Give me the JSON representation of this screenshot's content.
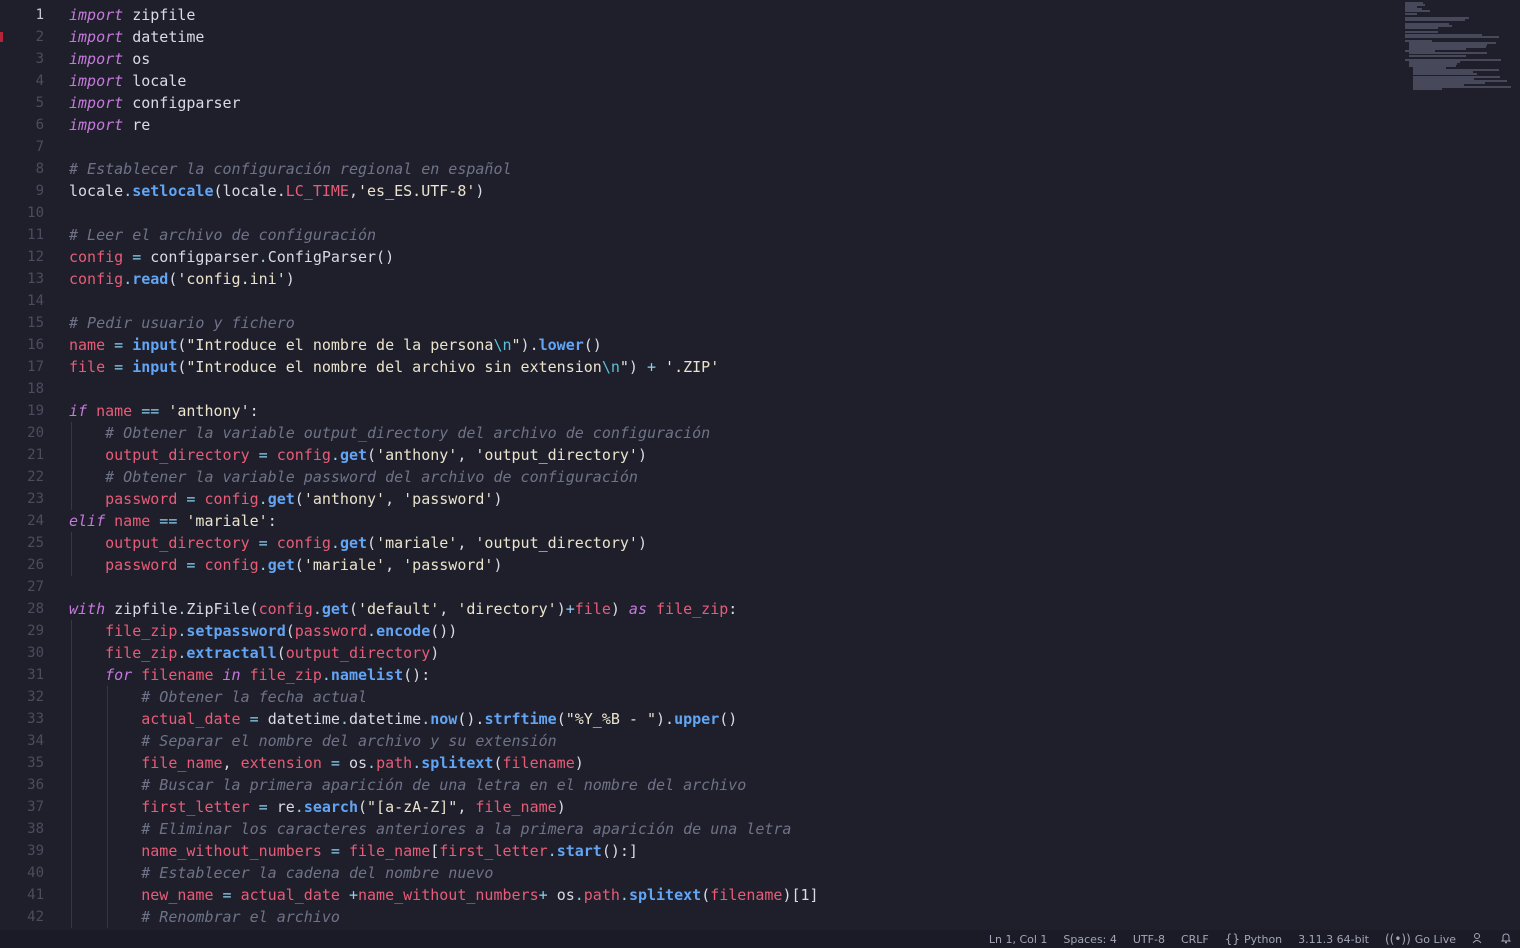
{
  "editor": {
    "language": "python",
    "active_line": 1,
    "lines": [
      {
        "n": "1",
        "indent": 0,
        "tokens": [
          [
            "kw",
            "import"
          ],
          [
            "pl",
            " zipfile"
          ]
        ]
      },
      {
        "n": "2",
        "indent": 0,
        "tokens": [
          [
            "kw",
            "import"
          ],
          [
            "pl",
            " datetime"
          ]
        ]
      },
      {
        "n": "3",
        "indent": 0,
        "tokens": [
          [
            "kw",
            "import"
          ],
          [
            "pl",
            " os"
          ]
        ]
      },
      {
        "n": "4",
        "indent": 0,
        "tokens": [
          [
            "kw",
            "import"
          ],
          [
            "pl",
            " locale"
          ]
        ]
      },
      {
        "n": "5",
        "indent": 0,
        "tokens": [
          [
            "kw",
            "import"
          ],
          [
            "pl",
            " configparser"
          ]
        ]
      },
      {
        "n": "6",
        "indent": 0,
        "tokens": [
          [
            "kw",
            "import"
          ],
          [
            "pl",
            " re"
          ]
        ]
      },
      {
        "n": "7",
        "indent": 0,
        "tokens": []
      },
      {
        "n": "8",
        "indent": 0,
        "tokens": [
          [
            "cm",
            "# Establecer la configuración regional en español"
          ]
        ]
      },
      {
        "n": "9",
        "indent": 0,
        "tokens": [
          [
            "pl",
            "locale"
          ],
          [
            "op",
            "."
          ],
          [
            "fn",
            "setlocale"
          ],
          [
            "pl",
            "(locale."
          ],
          [
            "var",
            "LC_TIME"
          ],
          [
            "pl",
            ","
          ],
          [
            "st",
            "'es_ES.UTF-8'"
          ],
          [
            "pl",
            ")"
          ]
        ]
      },
      {
        "n": "10",
        "indent": 0,
        "tokens": []
      },
      {
        "n": "11",
        "indent": 0,
        "tokens": [
          [
            "cm",
            "# Leer el archivo de configuración"
          ]
        ]
      },
      {
        "n": "12",
        "indent": 0,
        "tokens": [
          [
            "var",
            "config"
          ],
          [
            "op",
            " = "
          ],
          [
            "pl",
            "configparser"
          ],
          [
            "op",
            "."
          ],
          [
            "pl",
            "ConfigParser()"
          ]
        ]
      },
      {
        "n": "13",
        "indent": 0,
        "tokens": [
          [
            "var",
            "config"
          ],
          [
            "op",
            "."
          ],
          [
            "fn",
            "read"
          ],
          [
            "pl",
            "("
          ],
          [
            "st",
            "'config.ini'"
          ],
          [
            "pl",
            ")"
          ]
        ]
      },
      {
        "n": "14",
        "indent": 0,
        "tokens": []
      },
      {
        "n": "15",
        "indent": 0,
        "tokens": [
          [
            "cm",
            "# Pedir usuario y fichero"
          ]
        ]
      },
      {
        "n": "16",
        "indent": 0,
        "tokens": [
          [
            "var",
            "name"
          ],
          [
            "op",
            " = "
          ],
          [
            "fn",
            "input"
          ],
          [
            "pl",
            "("
          ],
          [
            "st",
            "\"Introduce el nombre de la persona"
          ],
          [
            "esc",
            "\\n"
          ],
          [
            "st",
            "\""
          ],
          [
            "pl",
            ")."
          ],
          [
            "fn",
            "lower"
          ],
          [
            "pl",
            "()"
          ]
        ]
      },
      {
        "n": "17",
        "indent": 0,
        "tokens": [
          [
            "var",
            "file"
          ],
          [
            "op",
            " = "
          ],
          [
            "fn",
            "input"
          ],
          [
            "pl",
            "("
          ],
          [
            "st",
            "\"Introduce el nombre del archivo sin extension"
          ],
          [
            "esc",
            "\\n"
          ],
          [
            "st",
            "\""
          ],
          [
            "pl",
            ")"
          ],
          [
            "op",
            " + "
          ],
          [
            "st",
            "'.ZIP'"
          ]
        ]
      },
      {
        "n": "18",
        "indent": 0,
        "tokens": []
      },
      {
        "n": "19",
        "indent": 0,
        "tokens": [
          [
            "kw",
            "if"
          ],
          [
            "var",
            " name"
          ],
          [
            "op",
            " == "
          ],
          [
            "st",
            "'anthony'"
          ],
          [
            "pl",
            ":"
          ]
        ]
      },
      {
        "n": "20",
        "indent": 1,
        "tokens": [
          [
            "cm",
            "# Obtener la variable output_directory del archivo de configuración"
          ]
        ]
      },
      {
        "n": "21",
        "indent": 1,
        "tokens": [
          [
            "var",
            "output_directory"
          ],
          [
            "op",
            " = "
          ],
          [
            "var",
            "config"
          ],
          [
            "op",
            "."
          ],
          [
            "fn",
            "get"
          ],
          [
            "pl",
            "("
          ],
          [
            "st",
            "'anthony'"
          ],
          [
            "pl",
            ", "
          ],
          [
            "st",
            "'output_directory'"
          ],
          [
            "pl",
            ")"
          ]
        ]
      },
      {
        "n": "22",
        "indent": 1,
        "tokens": [
          [
            "cm",
            "# Obtener la variable password del archivo de configuración"
          ]
        ]
      },
      {
        "n": "23",
        "indent": 1,
        "tokens": [
          [
            "var",
            "password"
          ],
          [
            "op",
            " = "
          ],
          [
            "var",
            "config"
          ],
          [
            "op",
            "."
          ],
          [
            "fn",
            "get"
          ],
          [
            "pl",
            "("
          ],
          [
            "st",
            "'anthony'"
          ],
          [
            "pl",
            ", "
          ],
          [
            "st",
            "'password'"
          ],
          [
            "pl",
            ")"
          ]
        ]
      },
      {
        "n": "24",
        "indent": 0,
        "tokens": [
          [
            "kw",
            "elif"
          ],
          [
            "var",
            " name"
          ],
          [
            "op",
            " == "
          ],
          [
            "st",
            "'mariale'"
          ],
          [
            "pl",
            ":"
          ]
        ]
      },
      {
        "n": "25",
        "indent": 1,
        "tokens": [
          [
            "var",
            "output_directory"
          ],
          [
            "op",
            " = "
          ],
          [
            "var",
            "config"
          ],
          [
            "op",
            "."
          ],
          [
            "fn",
            "get"
          ],
          [
            "pl",
            "("
          ],
          [
            "st",
            "'mariale'"
          ],
          [
            "pl",
            ", "
          ],
          [
            "st",
            "'output_directory'"
          ],
          [
            "pl",
            ")"
          ]
        ]
      },
      {
        "n": "26",
        "indent": 1,
        "tokens": [
          [
            "var",
            "password"
          ],
          [
            "op",
            " = "
          ],
          [
            "var",
            "config"
          ],
          [
            "op",
            "."
          ],
          [
            "fn",
            "get"
          ],
          [
            "pl",
            "("
          ],
          [
            "st",
            "'mariale'"
          ],
          [
            "pl",
            ", "
          ],
          [
            "st",
            "'password'"
          ],
          [
            "pl",
            ")"
          ]
        ]
      },
      {
        "n": "27",
        "indent": 0,
        "tokens": []
      },
      {
        "n": "28",
        "indent": 0,
        "tokens": [
          [
            "kw",
            "with"
          ],
          [
            "pl",
            " zipfile"
          ],
          [
            "op",
            "."
          ],
          [
            "pl",
            "ZipFile("
          ],
          [
            "var",
            "config"
          ],
          [
            "op",
            "."
          ],
          [
            "fn",
            "get"
          ],
          [
            "pl",
            "("
          ],
          [
            "st",
            "'default'"
          ],
          [
            "pl",
            ", "
          ],
          [
            "st",
            "'directory'"
          ],
          [
            "pl",
            ")"
          ],
          [
            "op",
            "+"
          ],
          [
            "var",
            "file"
          ],
          [
            "pl",
            ")"
          ],
          [
            "kw",
            " as"
          ],
          [
            "var",
            " file_zip"
          ],
          [
            "pl",
            ":"
          ]
        ]
      },
      {
        "n": "29",
        "indent": 1,
        "tokens": [
          [
            "var",
            "file_zip"
          ],
          [
            "op",
            "."
          ],
          [
            "fn",
            "setpassword"
          ],
          [
            "pl",
            "("
          ],
          [
            "var",
            "password"
          ],
          [
            "op",
            "."
          ],
          [
            "fn",
            "encode"
          ],
          [
            "pl",
            "())"
          ]
        ]
      },
      {
        "n": "30",
        "indent": 1,
        "tokens": [
          [
            "var",
            "file_zip"
          ],
          [
            "op",
            "."
          ],
          [
            "fn",
            "extractall"
          ],
          [
            "pl",
            "("
          ],
          [
            "var",
            "output_directory"
          ],
          [
            "pl",
            ")"
          ]
        ]
      },
      {
        "n": "31",
        "indent": 1,
        "tokens": [
          [
            "kw",
            "for"
          ],
          [
            "var",
            " filename"
          ],
          [
            "kw",
            " in"
          ],
          [
            "var",
            " file_zip"
          ],
          [
            "op",
            "."
          ],
          [
            "fn",
            "namelist"
          ],
          [
            "pl",
            "():"
          ]
        ]
      },
      {
        "n": "32",
        "indent": 2,
        "tokens": [
          [
            "cm",
            "# Obtener la fecha actual"
          ]
        ]
      },
      {
        "n": "33",
        "indent": 2,
        "tokens": [
          [
            "var",
            "actual_date"
          ],
          [
            "op",
            " = "
          ],
          [
            "pl",
            "datetime"
          ],
          [
            "op",
            "."
          ],
          [
            "pl",
            "datetime"
          ],
          [
            "op",
            "."
          ],
          [
            "fn",
            "now"
          ],
          [
            "pl",
            "()."
          ],
          [
            "fn",
            "strftime"
          ],
          [
            "pl",
            "("
          ],
          [
            "st",
            "\"%Y_%B - \""
          ],
          [
            "pl",
            ")."
          ],
          [
            "fn",
            "upper"
          ],
          [
            "pl",
            "()"
          ]
        ]
      },
      {
        "n": "34",
        "indent": 2,
        "tokens": [
          [
            "cm",
            "# Separar el nombre del archivo y su extensión"
          ]
        ]
      },
      {
        "n": "35",
        "indent": 2,
        "tokens": [
          [
            "var",
            "file_name"
          ],
          [
            "pl",
            ", "
          ],
          [
            "var",
            "extension"
          ],
          [
            "op",
            " = "
          ],
          [
            "pl",
            "os"
          ],
          [
            "op",
            "."
          ],
          [
            "var",
            "path"
          ],
          [
            "op",
            "."
          ],
          [
            "fn",
            "splitext"
          ],
          [
            "pl",
            "("
          ],
          [
            "var",
            "filename"
          ],
          [
            "pl",
            ")"
          ]
        ]
      },
      {
        "n": "36",
        "indent": 2,
        "tokens": [
          [
            "cm",
            "# Buscar la primera aparición de una letra en el nombre del archivo"
          ]
        ]
      },
      {
        "n": "37",
        "indent": 2,
        "tokens": [
          [
            "var",
            "first_letter"
          ],
          [
            "op",
            " = "
          ],
          [
            "pl",
            "re"
          ],
          [
            "op",
            "."
          ],
          [
            "fn",
            "search"
          ],
          [
            "pl",
            "("
          ],
          [
            "st",
            "\"[a-zA-Z]\""
          ],
          [
            "pl",
            ", "
          ],
          [
            "var",
            "file_name"
          ],
          [
            "pl",
            ")"
          ]
        ]
      },
      {
        "n": "38",
        "indent": 2,
        "tokens": [
          [
            "cm",
            "# Eliminar los caracteres anteriores a la primera aparición de una letra"
          ]
        ]
      },
      {
        "n": "39",
        "indent": 2,
        "tokens": [
          [
            "var",
            "name_without_numbers"
          ],
          [
            "op",
            " = "
          ],
          [
            "var",
            "file_name"
          ],
          [
            "pl",
            "["
          ],
          [
            "var",
            "first_letter"
          ],
          [
            "op",
            "."
          ],
          [
            "fn",
            "start"
          ],
          [
            "pl",
            "():]"
          ]
        ]
      },
      {
        "n": "40",
        "indent": 2,
        "tokens": [
          [
            "cm",
            "# Establecer la cadena del nombre nuevo"
          ]
        ]
      },
      {
        "n": "41",
        "indent": 2,
        "tokens": [
          [
            "var",
            "new_name"
          ],
          [
            "op",
            " = "
          ],
          [
            "var",
            "actual_date"
          ],
          [
            "op",
            " +"
          ],
          [
            "var",
            "name_without_numbers"
          ],
          [
            "op",
            "+ "
          ],
          [
            "pl",
            "os"
          ],
          [
            "op",
            "."
          ],
          [
            "var",
            "path"
          ],
          [
            "op",
            "."
          ],
          [
            "fn",
            "splitext"
          ],
          [
            "pl",
            "("
          ],
          [
            "var",
            "filename"
          ],
          [
            "pl",
            ")[1]"
          ]
        ]
      },
      {
        "n": "42",
        "indent": 2,
        "tokens": [
          [
            "cm",
            "# Renombrar el archivo"
          ]
        ]
      }
    ]
  },
  "colors": {
    "background": "#1e1f2b",
    "keyword": "#c678dd",
    "comment": "#6f7388",
    "variable": "#e85c77",
    "function": "#62a5f5",
    "string": "#ebe3cc",
    "operator": "#8fd0f0"
  },
  "statusbar": {
    "position": "Ln 1, Col 1",
    "spaces": "Spaces: 4",
    "encoding": "UTF-8",
    "eol": "CRLF",
    "language_icon": "braces-icon",
    "language": "Python",
    "interpreter": "3.11.3 64-bit",
    "golive_icon": "broadcast-icon",
    "golive": "Go Live",
    "feedback_icon": "person-feedback-icon",
    "bell_icon": "bell-icon"
  }
}
